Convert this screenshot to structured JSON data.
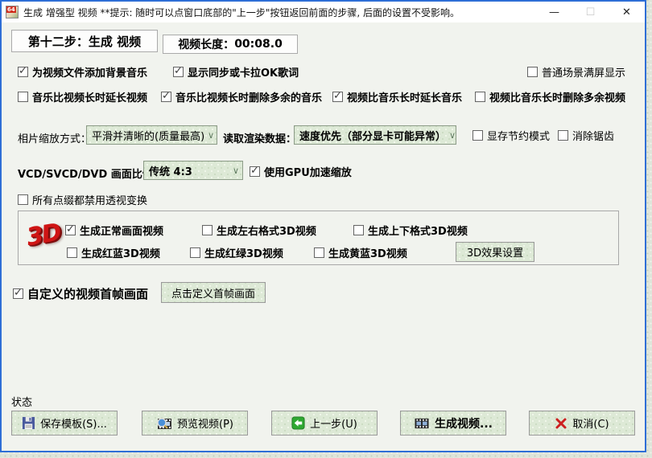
{
  "window": {
    "title": "生成 增强型 视频  **提示: 随时可以点窗口底部的\"上一步\"按钮返回前面的步骤, 后面的设置不受影响。",
    "controls": {
      "minimize": "—",
      "maximize": "☐",
      "close": "✕"
    }
  },
  "header": {
    "step_title": "第十二步：生成 视频",
    "video_length_label": "视频长度：",
    "video_length_value": "00:08.0"
  },
  "row1": [
    {
      "label": "为视频文件添加背景音乐",
      "checked": true
    },
    {
      "label": "显示同步或卡拉OK歌词",
      "checked": true
    },
    {
      "label": "普通场景满屏显示",
      "checked": false
    }
  ],
  "row2": [
    {
      "label": "音乐比视频长时延长视频",
      "checked": false
    },
    {
      "label": "音乐比视频长时删除多余的音乐",
      "checked": true
    },
    {
      "label": "视频比音乐长时延长音乐",
      "checked": true
    },
    {
      "label": "视频比音乐长时删除多余视频",
      "checked": false
    }
  ],
  "photo_scale": {
    "label": "相片缩放方式：",
    "value": "平滑并清晰的(质量最高)"
  },
  "render_source": {
    "label": "读取渲染数据：",
    "value": "速度优先（部分显卡可能异常）"
  },
  "vram_mode": {
    "label": "显存节约模式",
    "checked": false
  },
  "antialias": {
    "label": "消除锯齿",
    "checked": false
  },
  "aspect_ratio": {
    "label": "VCD/SVCD/DVD 画面比例:",
    "value": "传统 4:3"
  },
  "gpu_scale": {
    "label": "使用GPU加速缩放",
    "checked": true
  },
  "perspective_off": {
    "label": "所有点缀都禁用透视变换",
    "checked": false
  },
  "group3d": {
    "logo": "3D",
    "row1": [
      {
        "label": "生成正常画面视频",
        "checked": true
      },
      {
        "label": "生成左右格式3D视频",
        "checked": false
      },
      {
        "label": "生成上下格式3D视频",
        "checked": false
      }
    ],
    "row2": [
      {
        "label": "生成红蓝3D视频",
        "checked": false
      },
      {
        "label": "生成红绿3D视频",
        "checked": false
      },
      {
        "label": "生成黄蓝3D视频",
        "checked": false
      }
    ],
    "settings_button": "3D效果设置"
  },
  "first_frame": {
    "label": "自定义的视频首帧画面",
    "checked": true,
    "button_label": "点击定义首帧画面"
  },
  "status_label": "状态",
  "footer": {
    "buttons": [
      {
        "label": "保存模板(S)...",
        "icon": "floppy-disk-icon"
      },
      {
        "label": "预览视频(P)",
        "icon": "film-preview-icon"
      },
      {
        "label": "上一步(U)",
        "icon": "back-arrow-icon"
      },
      {
        "label": "生成视频...",
        "icon": "filmstrip-icon"
      },
      {
        "label": "取消(C)",
        "icon": "red-x-icon"
      }
    ]
  },
  "colors": {
    "window_border": "#2e6ed6",
    "button_texture_green": "#dde9d6",
    "logo_red": "#cf1515",
    "back_arrow_green": "#2fa832",
    "cancel_red": "#cc2020"
  }
}
